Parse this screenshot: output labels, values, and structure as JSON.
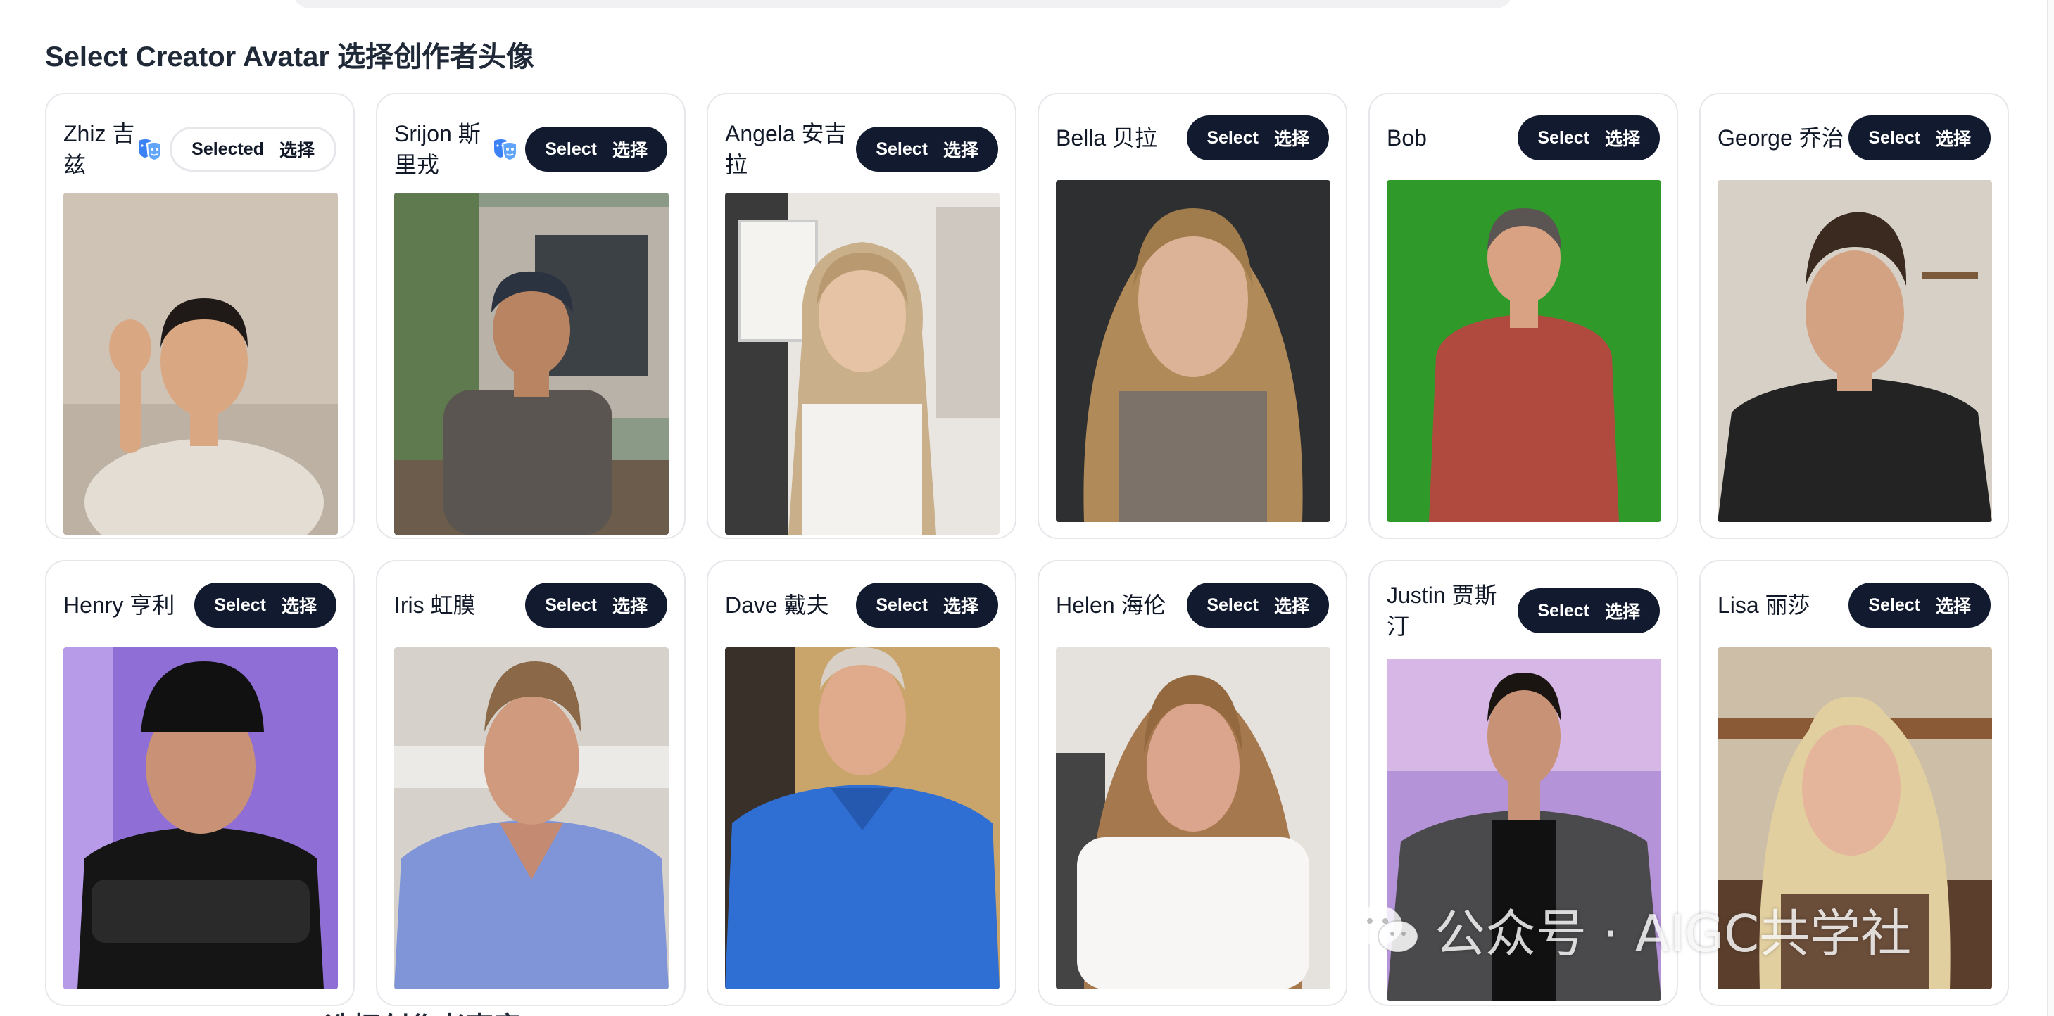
{
  "section_title": "Select Creator Avatar 选择创作者头像",
  "next_section_title": "Select Creator Voice 选择创作者声音",
  "watermark_text": "公众号 · AIGC共学社",
  "colors": {
    "button_bg": "#111a2e",
    "mask_icon": "#3b82f6"
  },
  "button": {
    "select": "Select",
    "select_zh": "选择",
    "selected": "Selected"
  },
  "avatars": [
    {
      "name": "Zhiz 吉兹",
      "state": "Selected",
      "mask_icon": true
    },
    {
      "name": "Srijon 斯里戎",
      "state": "Select",
      "mask_icon": true
    },
    {
      "name": "Angela 安吉拉",
      "state": "Select",
      "mask_icon": false
    },
    {
      "name": "Bella 贝拉",
      "state": "Select",
      "mask_icon": false
    },
    {
      "name": "Bob",
      "state": "Select",
      "mask_icon": false
    },
    {
      "name": "George 乔治",
      "state": "Select",
      "mask_icon": false
    },
    {
      "name": "Henry 亨利",
      "state": "Select",
      "mask_icon": false
    },
    {
      "name": "Iris 虹膜",
      "state": "Select",
      "mask_icon": false
    },
    {
      "name": "Dave 戴夫",
      "state": "Select",
      "mask_icon": false
    },
    {
      "name": "Helen 海伦",
      "state": "Select",
      "mask_icon": false
    },
    {
      "name": "Justin 贾斯汀",
      "state": "Select",
      "mask_icon": false
    },
    {
      "name": "Lisa 丽莎",
      "state": "Select",
      "mask_icon": false
    }
  ]
}
